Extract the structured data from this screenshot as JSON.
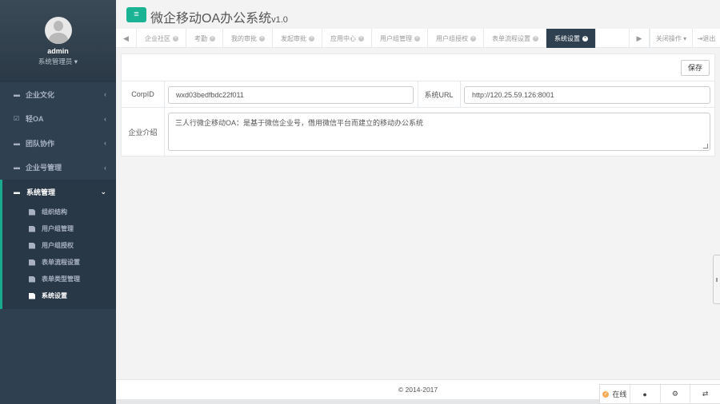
{
  "sidebar": {
    "profile": {
      "name": "admin",
      "role": "系统管理员 ▾"
    },
    "items": [
      {
        "label": "企业文化",
        "icon": "folder-icon",
        "chev": "‹"
      },
      {
        "label": "轻OA",
        "icon": "check-square-icon",
        "chev": "‹"
      },
      {
        "label": "团队协作",
        "icon": "folder-icon",
        "chev": "‹"
      },
      {
        "label": "企业号管理",
        "icon": "folder-icon",
        "chev": "‹"
      }
    ],
    "active_group": {
      "label": "系统管理",
      "chev": "⌄",
      "children": [
        "组织结构",
        "用户组管理",
        "用户组授权",
        "表单流程设置",
        "表单类型管理",
        "系统设置"
      ]
    }
  },
  "header": {
    "title": "微企移动OA办公系统",
    "version": "v1.0",
    "menu_glyph": "≡"
  },
  "tabs": {
    "left_arrow": "◀",
    "right_arrow": "▶",
    "items": [
      "企业社区",
      "考勤",
      "我的审批",
      "发起审批",
      "应用中心",
      "用户组管理",
      "用户组授权",
      "表单流程设置",
      "系统设置"
    ],
    "close_ops": "关闭操作 ▾",
    "logout": "⇥退出"
  },
  "form": {
    "save_label": "保存",
    "corpid_label": "CorpID",
    "corpid_value": "wxd03bedfbdc22f011",
    "url_label": "系统URL",
    "url_value": "http://120.25.59.126:8001",
    "intro_label": "企业介绍",
    "intro_value": "三人行微企移动OA：是基于微信企业号，借用微信平台而建立的移动办公系统"
  },
  "footer": {
    "copyright": "© 2014-2017"
  },
  "chat_bar": {
    "online_label": "在线",
    "online_glyph": "✓",
    "chat_glyph": "💬",
    "settings_glyph": "⚙",
    "swap_glyph": "⇄"
  },
  "colors": {
    "sidebar": "#2f4050",
    "accent": "#1ab394",
    "active_tab": "#2f4050"
  }
}
